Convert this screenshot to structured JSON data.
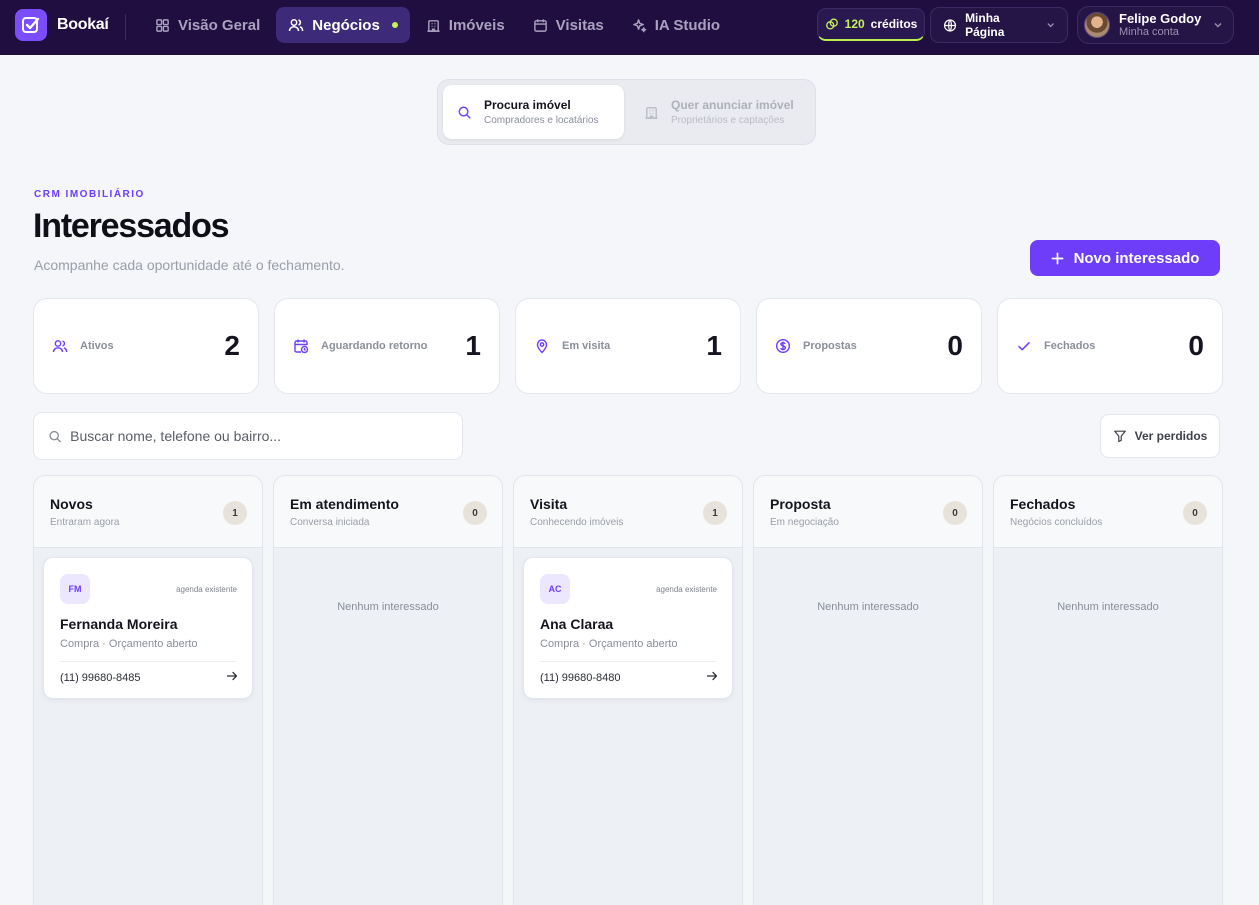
{
  "topbar": {
    "brand": "Bookaí",
    "nav": [
      {
        "label": "Visão Geral",
        "icon": "grid-icon",
        "active": false
      },
      {
        "label": "Negócios",
        "icon": "users-icon",
        "active": true
      },
      {
        "label": "Imóveis",
        "icon": "building-icon",
        "active": false
      },
      {
        "label": "Visitas",
        "icon": "calendar-icon",
        "active": false
      },
      {
        "label": "IA Studio",
        "icon": "sparkles-icon",
        "active": false
      }
    ],
    "credits_value": "120",
    "credits_label": "créditos",
    "my_page": "Minha Página",
    "user_name": "Felipe Godoy",
    "user_sub": "Minha conta"
  },
  "mode_toggle": {
    "options": [
      {
        "title": "Procura imóvel",
        "sub": "Compradores e locatários",
        "icon": "search-icon",
        "active": true
      },
      {
        "title": "Quer anunciar imóvel",
        "sub": "Proprietários e captações",
        "icon": "building-icon",
        "active": false
      }
    ]
  },
  "header": {
    "eyebrow": "CRM IMOBILIÁRIO",
    "title": "Interessados",
    "subtitle": "Acompanhe cada oportunidade até o fechamento.",
    "new_button": "Novo interessado"
  },
  "stats": [
    {
      "label": "Ativos",
      "value": "2",
      "icon": "users-icon"
    },
    {
      "label": "Aguardando retorno",
      "value": "1",
      "icon": "calendar-clock-icon"
    },
    {
      "label": "Em visita",
      "value": "1",
      "icon": "map-pin-icon"
    },
    {
      "label": "Propostas",
      "value": "0",
      "icon": "dollar-icon"
    },
    {
      "label": "Fechados",
      "value": "0",
      "icon": "check-icon"
    }
  ],
  "search": {
    "placeholder": "Buscar nome, telefone ou bairro..."
  },
  "filter_button": "Ver perdidos",
  "columns": [
    {
      "title": "Novos",
      "sub": "Entraram agora",
      "count": "1",
      "cards": [
        {
          "initials": "FM",
          "tag": "agenda existente",
          "name": "Fernanda Moreira",
          "meta": "Compra · Orçamento aberto",
          "phone": "(11) 99680-8485"
        }
      ]
    },
    {
      "title": "Em atendimento",
      "sub": "Conversa iniciada",
      "count": "0",
      "empty": "Nenhum interessado",
      "cards": []
    },
    {
      "title": "Visita",
      "sub": "Conhecendo imóveis",
      "count": "1",
      "cards": [
        {
          "initials": "AC",
          "tag": "agenda existente",
          "name": "Ana Claraa",
          "meta": "Compra · Orçamento aberto",
          "phone": "(11) 99680-8480"
        }
      ]
    },
    {
      "title": "Proposta",
      "sub": "Em negociação",
      "count": "0",
      "empty": "Nenhum interessado",
      "cards": []
    },
    {
      "title": "Fechados",
      "sub": "Negócios concluídos",
      "count": "0",
      "empty": "Nenhum interessado",
      "cards": []
    }
  ],
  "colors": {
    "nav_bg": "#1f0e3f",
    "accent": "#6d3dfa",
    "credit_accent": "#c6f25a"
  }
}
